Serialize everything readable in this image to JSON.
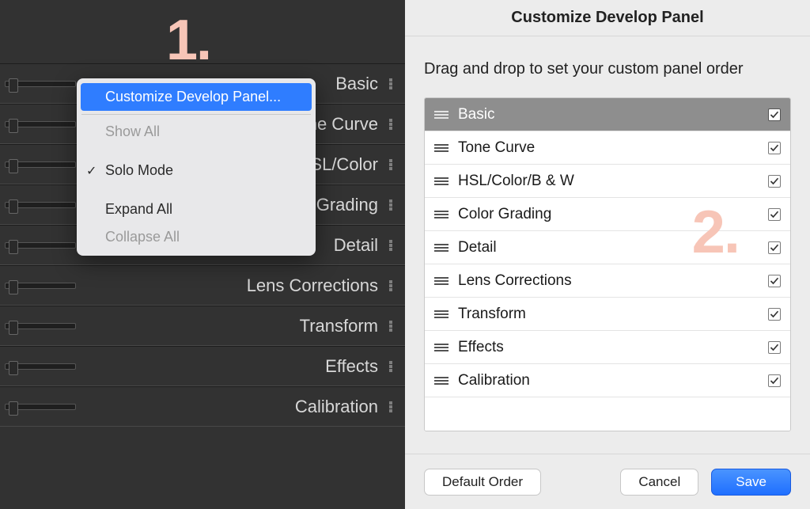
{
  "annotations": {
    "one": "1.",
    "two": "2."
  },
  "develop_panels": [
    "Basic",
    "Tone Curve",
    "HSL/Color",
    "Color Grading",
    "Detail",
    "Lens Corrections",
    "Transform",
    "Effects",
    "Calibration"
  ],
  "context_menu": {
    "customize": "Customize Develop Panel...",
    "show_all": "Show All",
    "solo_mode": "Solo Mode",
    "expand_all": "Expand All",
    "collapse_all": "Collapse All"
  },
  "dialog": {
    "title": "Customize Develop Panel",
    "instruction": "Drag and drop to set your custom panel order",
    "items": [
      {
        "label": "Basic",
        "checked": true,
        "selected": true
      },
      {
        "label": "Tone Curve",
        "checked": true,
        "selected": false
      },
      {
        "label": "HSL/Color/B & W",
        "checked": true,
        "selected": false
      },
      {
        "label": "Color Grading",
        "checked": true,
        "selected": false
      },
      {
        "label": "Detail",
        "checked": true,
        "selected": false
      },
      {
        "label": "Lens Corrections",
        "checked": true,
        "selected": false
      },
      {
        "label": "Transform",
        "checked": true,
        "selected": false
      },
      {
        "label": "Effects",
        "checked": true,
        "selected": false
      },
      {
        "label": "Calibration",
        "checked": true,
        "selected": false
      }
    ],
    "buttons": {
      "default_order": "Default Order",
      "cancel": "Cancel",
      "save": "Save"
    }
  }
}
